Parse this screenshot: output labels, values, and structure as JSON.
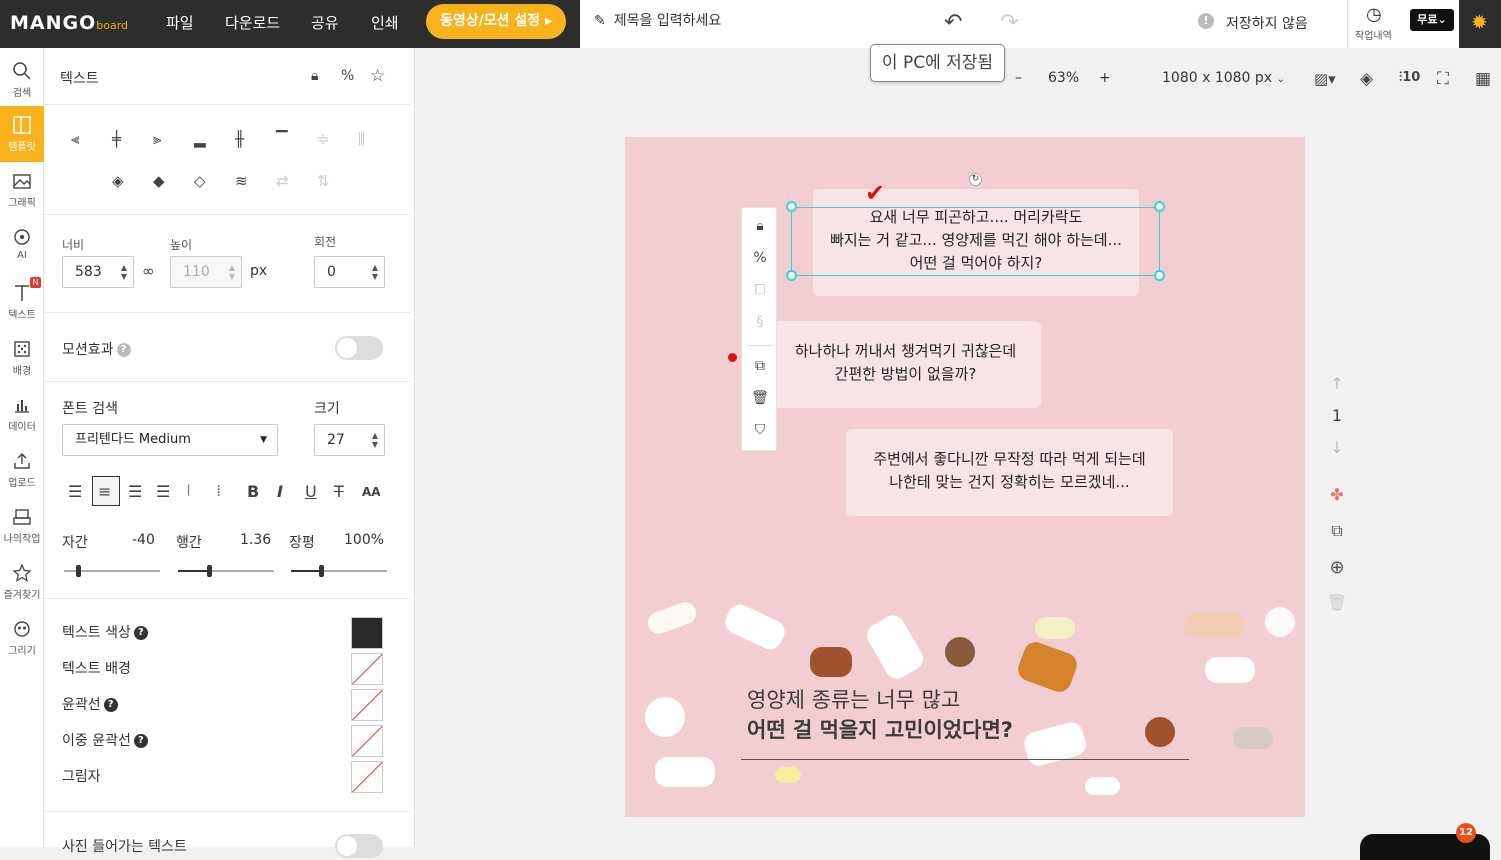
{
  "app": {
    "logo_main": "MANGO",
    "logo_sub": "board",
    "menu": [
      "파일",
      "다운로드",
      "공유",
      "인쇄"
    ],
    "motion_button": "동영상/모션 설정",
    "title_placeholder": "제목을 입력하세요",
    "save_status": "저장하지 않음",
    "history_label": "작업내역",
    "plan_label": "무료",
    "tooltip": "이 PC에 저장됨"
  },
  "sidebar": [
    {
      "label": "검색",
      "icon": "search-icon"
    },
    {
      "label": "템플릿",
      "icon": "template-icon"
    },
    {
      "label": "그래픽",
      "icon": "graphic-icon"
    },
    {
      "label": "AI",
      "icon": "ai-icon"
    },
    {
      "label": "텍스트",
      "icon": "text-icon",
      "badge": "N"
    },
    {
      "label": "배경",
      "icon": "background-icon"
    },
    {
      "label": "데이터",
      "icon": "chart-icon"
    },
    {
      "label": "업로드",
      "icon": "upload-icon"
    },
    {
      "label": "나의작업",
      "icon": "my-work-icon"
    },
    {
      "label": "즐겨찾기",
      "icon": "star-icon"
    },
    {
      "label": "그리기",
      "icon": "draw-icon"
    }
  ],
  "panel": {
    "title": "텍스트",
    "width_label": "너비",
    "width_value": "583",
    "height_label": "높이",
    "height_value": "110",
    "unit": "px",
    "rotate_label": "회전",
    "rotate_value": "0",
    "motion_label": "모션효과",
    "font_search_label": "폰트 검색",
    "font_value": "프리텐다드 Medium",
    "size_label": "크기",
    "size_value": "27",
    "letter_spacing_label": "자간",
    "letter_spacing_value": "-40",
    "line_height_label": "행간",
    "line_height_value": "1.36",
    "width_ratio_label": "장평",
    "width_ratio_value": "100%",
    "text_color_label": "텍스트 색상",
    "text_color": "#222222",
    "text_bg_label": "텍스트 배경",
    "outline_label": "윤곽선",
    "double_outline_label": "이중 윤곽선",
    "shadow_label": "그림자",
    "photo_text_label": "사진 들어가는 텍스트"
  },
  "zoom": {
    "value": "63%",
    "size": "1080 x 1080 px"
  },
  "page_nav": {
    "current": "1"
  },
  "design": {
    "bubble1": [
      "요새 너무 피곤하고.... 머리카락도",
      "빠지는 거 같고... 영양제를 먹긴 해야 하는데...",
      "어떤 걸 먹어야 하지?"
    ],
    "bubble2": [
      "하나하나 꺼내서 챙겨먹기 귀찮은데",
      "간편한 방법이 없을까?"
    ],
    "bubble3": [
      "주변에서 좋다니깐 무작정 따라 먹게 되는데",
      "나한테 맞는 건지 정확히는 모르겠네..."
    ],
    "headline1": "영양제 종류는 너무 많고",
    "headline2": "어떤 걸 먹을지 고민이었다면?"
  },
  "notification_count": "12"
}
